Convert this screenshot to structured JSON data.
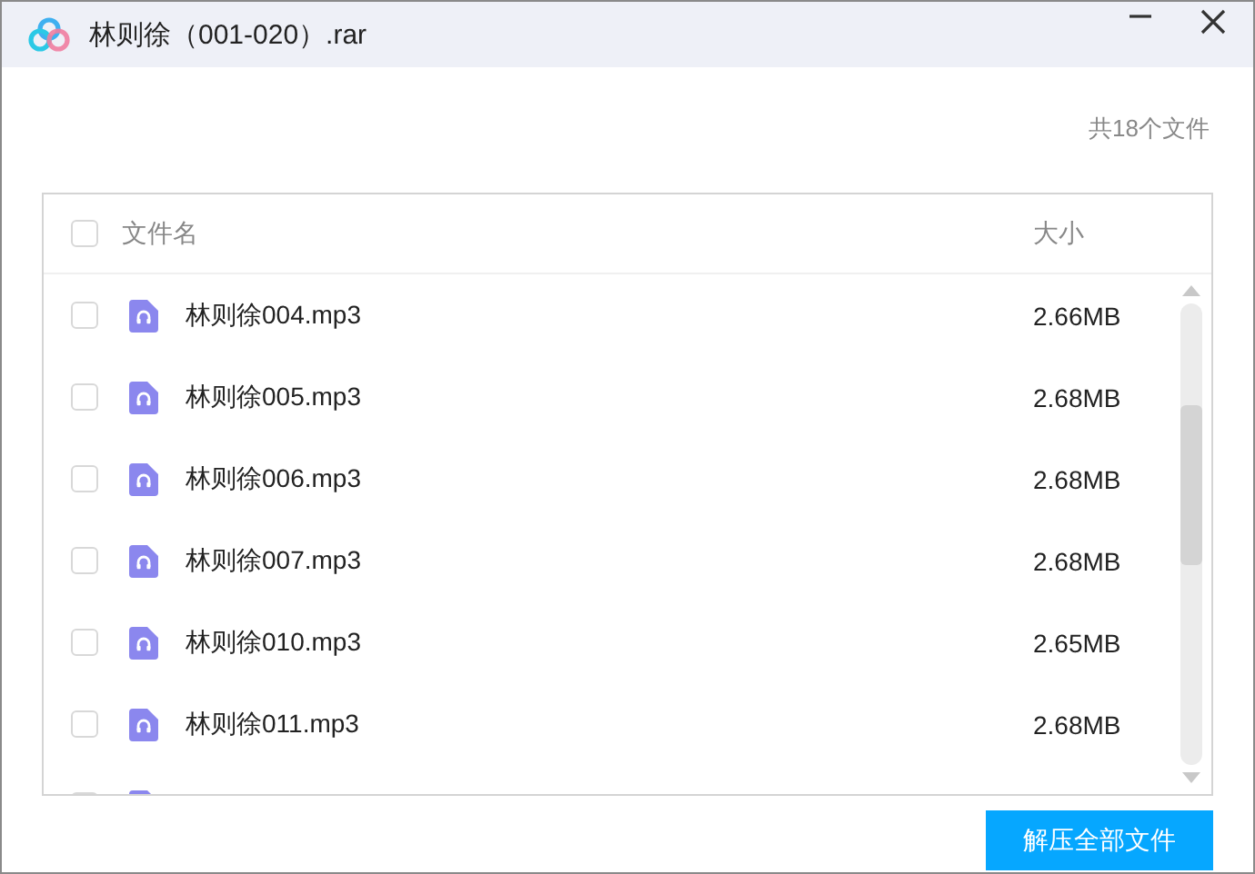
{
  "window": {
    "title": "林则徐（001-020）.rar"
  },
  "file_count": "共18个文件",
  "table": {
    "select_all": {
      "checked": false
    },
    "columns": [
      "文件名",
      "大小"
    ],
    "rows": [
      {
        "name": "林则徐004.mp3",
        "size": "2.66MB",
        "checked": false
      },
      {
        "name": "林则徐005.mp3",
        "size": "2.68MB",
        "checked": false
      },
      {
        "name": "林则徐006.mp3",
        "size": "2.68MB",
        "checked": false
      },
      {
        "name": "林则徐007.mp3",
        "size": "2.68MB",
        "checked": false
      },
      {
        "name": "林则徐010.mp3",
        "size": "2.65MB",
        "checked": false
      },
      {
        "name": "林则徐011.mp3",
        "size": "2.68MB",
        "checked": false
      },
      {
        "checked": false
      }
    ]
  },
  "extract_button": "解压全部文件"
}
